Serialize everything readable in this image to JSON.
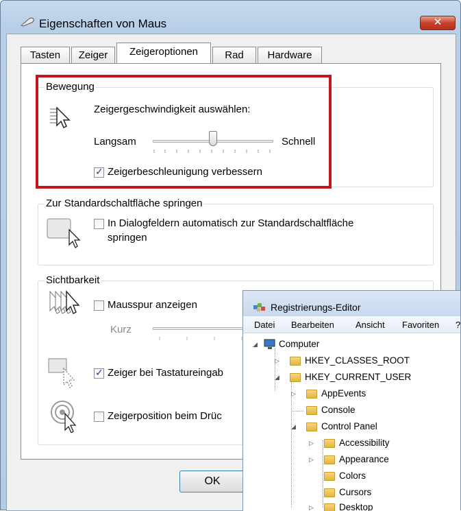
{
  "mouse_dialog": {
    "title": "Eigenschaften von Maus",
    "close_symbol": "✕",
    "tabs": [
      "Tasten",
      "Zeiger",
      "Zeigeroptionen",
      "Rad",
      "Hardware"
    ],
    "active_tab": "Zeigeroptionen",
    "motion": {
      "group_title": "Bewegung",
      "speed_label": "Zeigergeschwindigkeit auswählen:",
      "slow_label": "Langsam",
      "fast_label": "Schnell",
      "speed_value_fraction": 0.5,
      "enhance_precision_label": "Zeigerbeschleunigung verbessern",
      "enhance_precision_checked": true
    },
    "snap_to": {
      "group_title": "Zur Standardschaltfläche springen",
      "checkbox_label_line1": "In Dialogfeldern automatisch zur Standardschaltfläche",
      "checkbox_label_line2": "springen",
      "checked": false
    },
    "visibility": {
      "group_title": "Sichtbarkeit",
      "trails_label": "Mausspur anzeigen",
      "trails_checked": false,
      "trails_short_label": "Kurz",
      "hide_while_typing_label": "Zeiger bei Tastatureingab",
      "hide_while_typing_checked": true,
      "show_location_label": "Zeigerposition beim Drüc",
      "show_location_checked": false
    },
    "ok_label": "OK",
    "highlight_color": "#c4161c"
  },
  "registry_editor": {
    "title": "Registrierungs-Editor",
    "menu": [
      "Datei",
      "Bearbeiten",
      "Ansicht",
      "Favoriten",
      "?"
    ],
    "tree": {
      "root": "Computer",
      "hkcr": "HKEY_CLASSES_ROOT",
      "hkcu": "HKEY_CURRENT_USER",
      "appevents": "AppEvents",
      "console": "Console",
      "control_panel": "Control Panel",
      "accessibility": "Accessibility",
      "appearance": "Appearance",
      "colors": "Colors",
      "cursors": "Cursors",
      "desktop": "Desktop"
    }
  }
}
